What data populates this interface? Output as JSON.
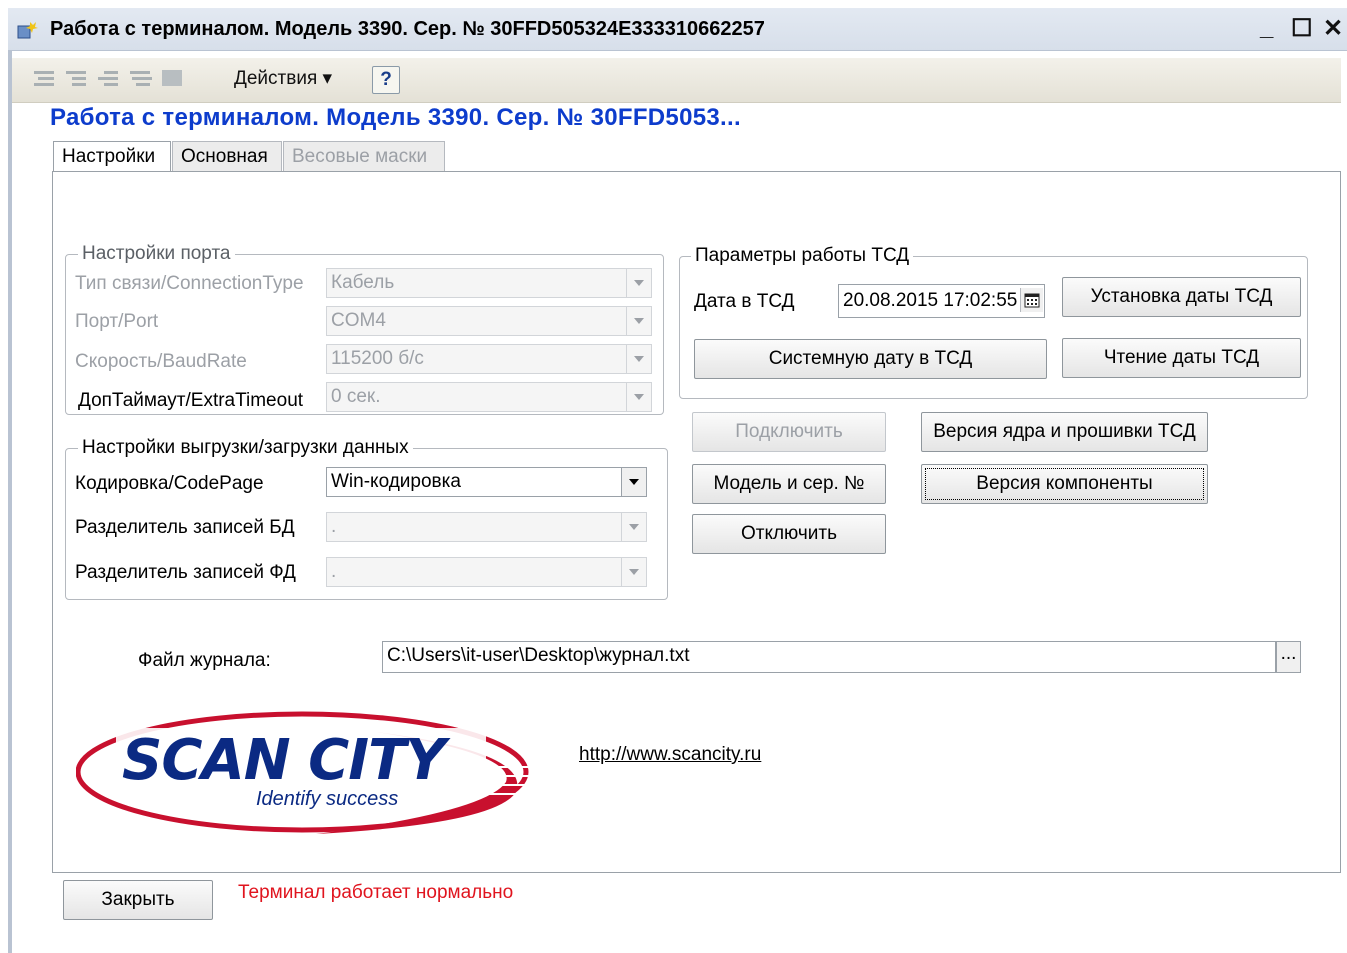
{
  "window": {
    "title": "Работа с терминалом. Модель 3390. Сер. № 30FFD505324E333310662257",
    "minimize": "_",
    "maximize": "☐",
    "close": "✕"
  },
  "toolbar": {
    "actions_label": "Действия ▾",
    "help_label": "?"
  },
  "form_title": "Работа с терминалом. Модель 3390. Сер. № 30FFD5053...",
  "tabs": [
    {
      "label": "Настройки",
      "active": true
    },
    {
      "label": "Основная",
      "active": false
    },
    {
      "label": "Весовые маски",
      "disabled": true
    }
  ],
  "port_settings": {
    "title": "Настройки порта",
    "connection_type": {
      "label": "Тип связи/ConnectionType",
      "value": "Кабель"
    },
    "port": {
      "label": "Порт/Port",
      "value": "COM4"
    },
    "baud": {
      "label": "Скорость/BaudRate",
      "value": "115200 б/с"
    },
    "timeout": {
      "label": "ДопТаймаут/ExtraTimeout",
      "value": "0 сек."
    }
  },
  "data_settings": {
    "title": "Настройки выгрузки/загрузки данных",
    "codepage": {
      "label": "Кодировка/CodePage",
      "value": "Win-кодировка"
    },
    "db_sep": {
      "label": "Разделитель записей БД",
      "value": "."
    },
    "fd_sep": {
      "label": "Разделитель записей ФД",
      "value": "."
    }
  },
  "tsd_params": {
    "title": "Параметры работы ТСД",
    "date_label": "Дата в ТСД",
    "date_value": "20.08.2015 17:02:55",
    "set_date": "Установка даты ТСД",
    "system_date": "Системную дату в ТСД",
    "read_date": "Чтение даты ТСД"
  },
  "actions": {
    "connect": "Подключить",
    "model_serial": "Модель и сер. №",
    "disconnect": "Отключить",
    "kernel_version": "Версия ядра и прошивки ТСД",
    "component_version": "Версия компоненты"
  },
  "log_file": {
    "label": "Файл журнала:",
    "value": "C:\\Users\\it-user\\Desktop\\журнал.txt",
    "browse": "..."
  },
  "logo": {
    "text": "SCAN CITY",
    "tagline": "Identify success"
  },
  "link": "http://www.scancity.ru",
  "footer": {
    "close": "Закрыть",
    "status": "Терминал работает нормально"
  },
  "colors": {
    "title_blue": "#0d3ccc",
    "logo_navy": "#0b2a83",
    "logo_red": "#c8102e",
    "status_red": "#e0141e"
  }
}
